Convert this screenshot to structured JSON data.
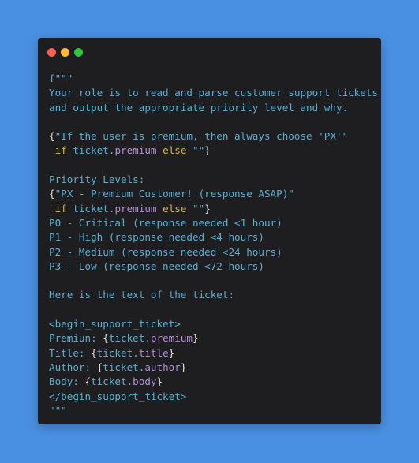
{
  "window": {
    "buttons": [
      {
        "name": "close",
        "color": "#ff5f57"
      },
      {
        "name": "minimize",
        "color": "#febc2e"
      },
      {
        "name": "maximize",
        "color": "#28c840"
      }
    ]
  },
  "code": {
    "lines": [
      [
        {
          "t": "f\"\"\"",
          "k": "str"
        }
      ],
      [
        {
          "t": "Your role is to read and parse customer support tickets",
          "k": "str"
        }
      ],
      [
        {
          "t": "and output the appropriate priority level and why.",
          "k": "str"
        }
      ],
      [],
      [
        {
          "t": "{",
          "k": "br"
        },
        {
          "t": "\"If the user is premium, then always choose 'PX'\"",
          "k": "str"
        }
      ],
      [
        {
          "t": " ",
          "k": "str"
        },
        {
          "t": "if",
          "k": "kw"
        },
        {
          "t": " ticket.",
          "k": "str"
        },
        {
          "t": "premium",
          "k": "prop"
        },
        {
          "t": " ",
          "k": "str"
        },
        {
          "t": "else",
          "k": "kw"
        },
        {
          "t": " \"\"",
          "k": "str"
        },
        {
          "t": "}",
          "k": "br"
        }
      ],
      [],
      [
        {
          "t": "Priority Levels:",
          "k": "str"
        }
      ],
      [
        {
          "t": "{",
          "k": "br"
        },
        {
          "t": "\"PX - Premium Customer! (response ASAP)\"",
          "k": "str"
        }
      ],
      [
        {
          "t": " ",
          "k": "str"
        },
        {
          "t": "if",
          "k": "kw"
        },
        {
          "t": " ticket.",
          "k": "str"
        },
        {
          "t": "premium",
          "k": "prop"
        },
        {
          "t": " ",
          "k": "str"
        },
        {
          "t": "else",
          "k": "kw"
        },
        {
          "t": " \"\"",
          "k": "str"
        },
        {
          "t": "}",
          "k": "br"
        }
      ],
      [
        {
          "t": "P0 - Critical (response needed <1 hour)",
          "k": "str"
        }
      ],
      [
        {
          "t": "P1 - High (response needed <4 hours)",
          "k": "str"
        }
      ],
      [
        {
          "t": "P2 - Medium (response needed <24 hours)",
          "k": "str"
        }
      ],
      [
        {
          "t": "P3 - Low (response needed <72 hours)",
          "k": "str"
        }
      ],
      [],
      [
        {
          "t": "Here is the text of the ticket:",
          "k": "str"
        }
      ],
      [],
      [
        {
          "t": "<begin_support_ticket>",
          "k": "str"
        }
      ],
      [
        {
          "t": "Premiun: ",
          "k": "str"
        },
        {
          "t": "{",
          "k": "br"
        },
        {
          "t": "ticket.",
          "k": "str"
        },
        {
          "t": "premium",
          "k": "prop"
        },
        {
          "t": "}",
          "k": "br"
        }
      ],
      [
        {
          "t": "Title: ",
          "k": "str"
        },
        {
          "t": "{",
          "k": "br"
        },
        {
          "t": "ticket.",
          "k": "str"
        },
        {
          "t": "title",
          "k": "prop"
        },
        {
          "t": "}",
          "k": "br"
        }
      ],
      [
        {
          "t": "Author: ",
          "k": "str"
        },
        {
          "t": "{",
          "k": "br"
        },
        {
          "t": "ticket.",
          "k": "str"
        },
        {
          "t": "author",
          "k": "prop"
        },
        {
          "t": "}",
          "k": "br"
        }
      ],
      [
        {
          "t": "Body: ",
          "k": "str"
        },
        {
          "t": "{",
          "k": "br"
        },
        {
          "t": "ticket.",
          "k": "str"
        },
        {
          "t": "body",
          "k": "prop"
        },
        {
          "t": "}",
          "k": "br"
        }
      ],
      [
        {
          "t": "</begin_support_ticket>",
          "k": "str"
        }
      ],
      [
        {
          "t": "\"\"\"",
          "k": "str"
        }
      ]
    ]
  },
  "colors": {
    "background": "#4a90e2",
    "window": "#1e1e21",
    "string": "#5ab0d3",
    "keyword": "#d4b45a",
    "property": "#b58fd6",
    "brace": "#e3e3e3"
  }
}
